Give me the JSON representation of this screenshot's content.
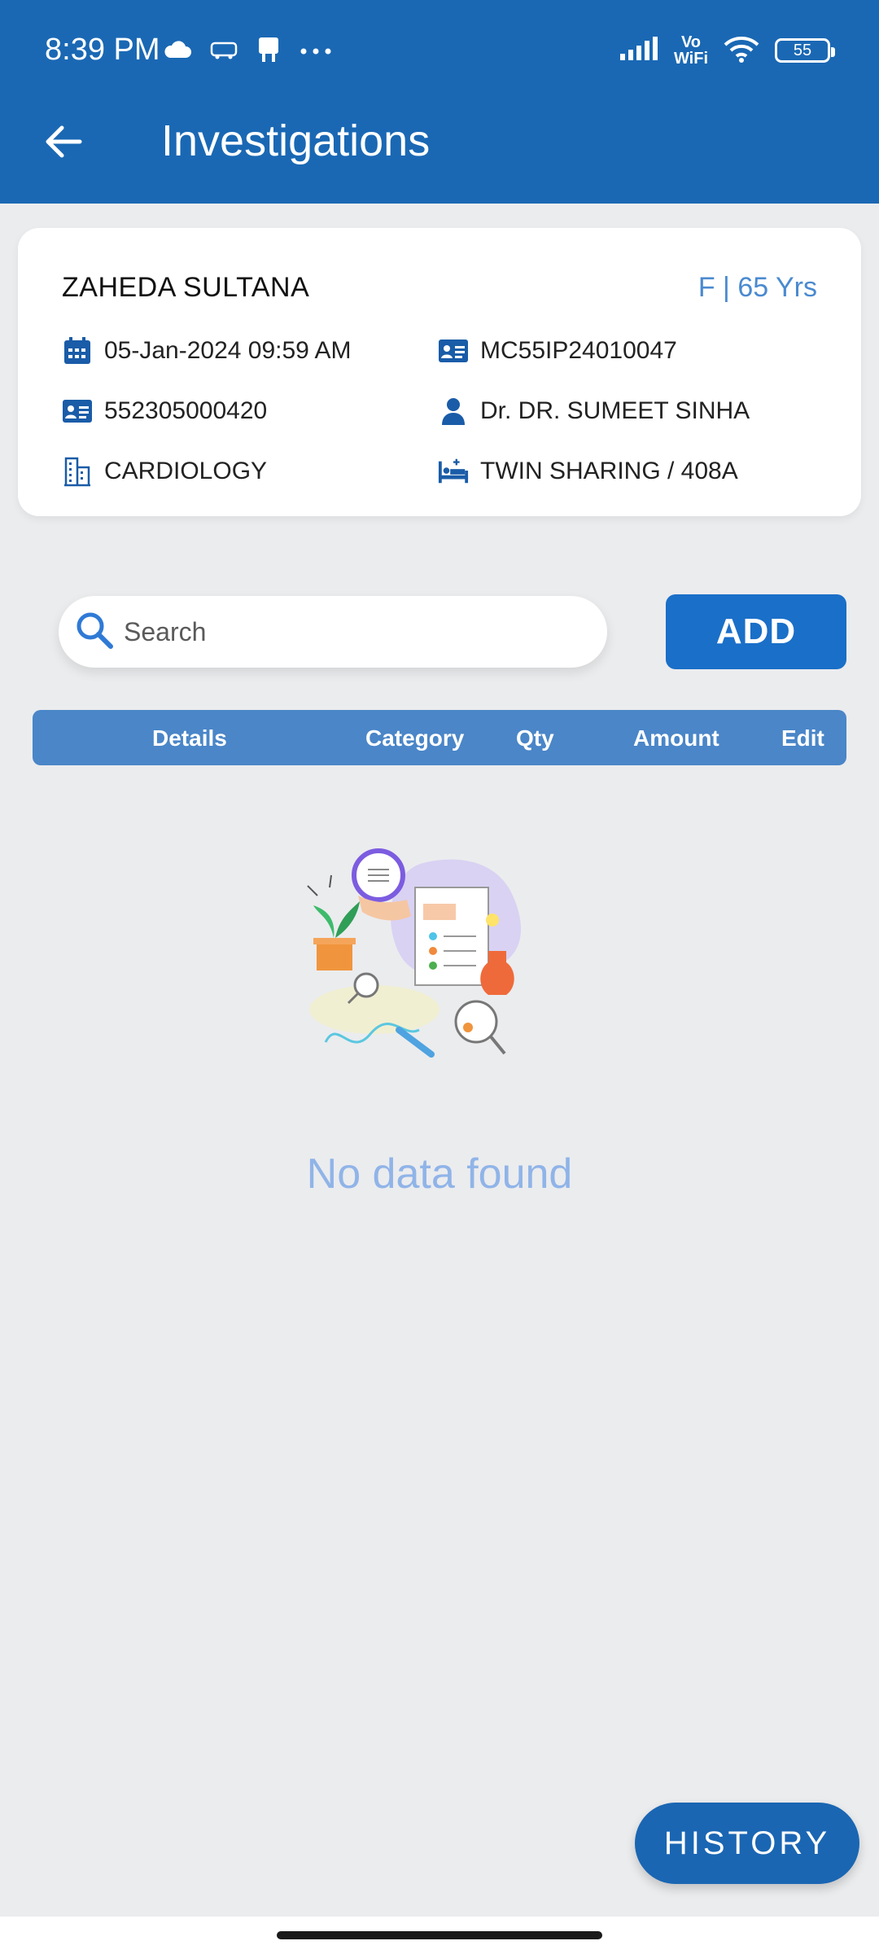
{
  "status_bar": {
    "time": "8:39 PM",
    "vowifi_top": "Vo",
    "vowifi_bottom": "WiFi",
    "battery": "55",
    "icons_left": [
      "cloud-icon",
      "redbus-icon",
      "notification-app-icon",
      "more-dots-icon"
    ],
    "icons_right": [
      "signal-icon",
      "vowifi-icon",
      "wifi-icon",
      "battery-icon"
    ]
  },
  "header": {
    "title": "Investigations"
  },
  "patient": {
    "name": "ZAHEDA SULTANA",
    "sex_age": "F | 65 Yrs",
    "datetime": "05-Jan-2024 09:59 AM",
    "ip_number": "MC55IP24010047",
    "uhid": "552305000420",
    "doctor": "Dr. DR. SUMEET SINHA",
    "department": "CARDIOLOGY",
    "bed": "TWIN SHARING / 408A"
  },
  "search": {
    "placeholder": "Search"
  },
  "add_label": "ADD",
  "table": {
    "headers": [
      "Details",
      "Category",
      "Qty",
      "Amount",
      "Edit"
    ]
  },
  "empty_state": {
    "message": "No data found"
  },
  "history_label": "HISTORY",
  "colors": {
    "primary": "#1a68b4",
    "accent": "#4a8ad0",
    "table_header": "#4a86c8",
    "empty_text": "#90b4e8"
  }
}
